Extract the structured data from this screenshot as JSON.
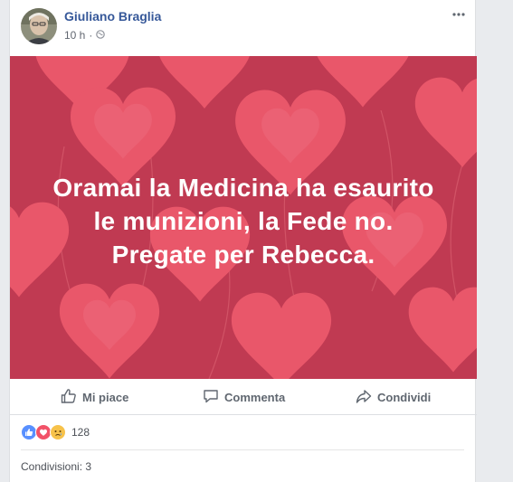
{
  "post": {
    "author": "Giuliano Braglia",
    "time": "10 h",
    "privacy_icon": "globe-icon",
    "more_icon": "more-options-icon",
    "image": {
      "background_color": "#c03a52",
      "heart_color": "#e9576a",
      "text_lines": [
        "Oramai la Medicina ha esaurito",
        "le munizioni, la Fede no.",
        "Pregate per Rebecca."
      ]
    },
    "actions": {
      "like": "Mi piace",
      "comment": "Commenta",
      "share": "Condividi"
    },
    "reactions": {
      "icons": [
        "like-reaction-icon",
        "love-reaction-icon",
        "sad-reaction-icon"
      ],
      "count": "128"
    },
    "shares_text": "Condivisioni: 3"
  }
}
